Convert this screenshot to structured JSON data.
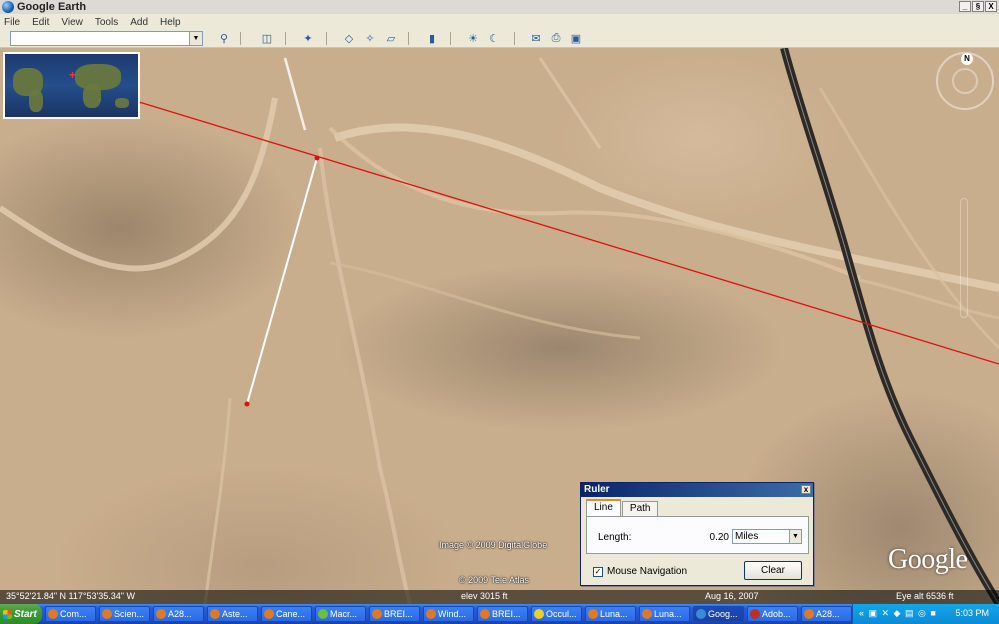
{
  "window": {
    "title": "Google Earth",
    "controls": [
      "_",
      "§",
      "X"
    ]
  },
  "menu": {
    "items": [
      "File",
      "Edit",
      "View",
      "Tools",
      "Add",
      "Help"
    ]
  },
  "search": {
    "value": ""
  },
  "map": {
    "credits": {
      "imagery": "Image © 2009 DigitalGlobe",
      "atlas": "© 2009 Tele Atlas"
    },
    "logo": "Google",
    "compass_label": "N"
  },
  "status": {
    "coords": "35°52'21.84\" N    117°53'35.34\" W",
    "elev": "elev  3015 ft",
    "date": "Aug 16, 2007",
    "eye_alt": "Eye alt    6536 ft"
  },
  "ruler": {
    "title": "Ruler",
    "close": "x",
    "tabs": [
      "Line",
      "Path"
    ],
    "length_label": "Length:",
    "length_value": "0.20",
    "units": "Miles",
    "mouse_nav_label": "Mouse Navigation",
    "mouse_nav_checked": true,
    "clear_label": "Clear"
  },
  "taskbar": {
    "start_label": "Start",
    "tasks": [
      "Com...",
      "Scien...",
      "A28...",
      "Aste...",
      "Cane...",
      "Macr...",
      "BREI...",
      "Wind...",
      "BREI...",
      "Occul...",
      "Luna...",
      "Luna...",
      "Goog...",
      "Adob...",
      "A28..."
    ],
    "active_index": 12,
    "tray_icons": "« ▣ ✕ ◆ ▤ ◎ ■",
    "clock": "5:03 PM"
  }
}
